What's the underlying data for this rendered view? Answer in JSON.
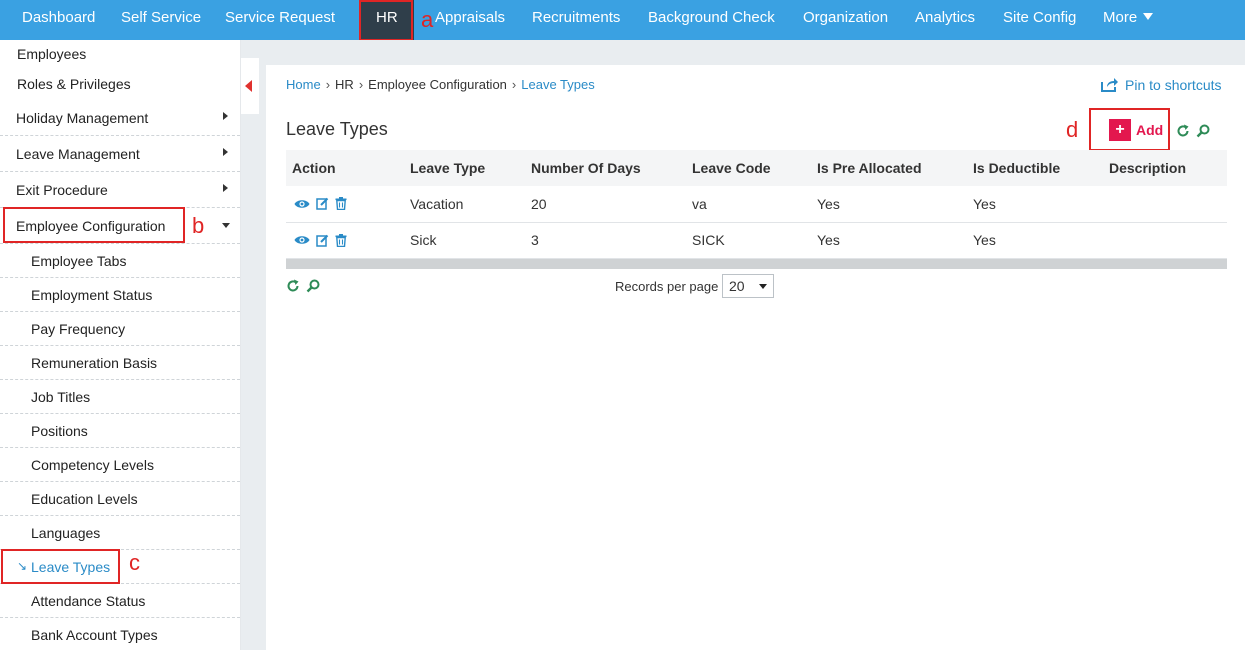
{
  "topnav": {
    "items": [
      "Dashboard",
      "Self Service",
      "Service Request",
      "HR",
      "Appraisals",
      "Recruitments",
      "Background Check",
      "Organization",
      "Analytics",
      "Site Config",
      "More"
    ],
    "active": "HR"
  },
  "annotations": {
    "a": "a",
    "b": "b",
    "c": "c",
    "d": "d"
  },
  "sidebar": {
    "top_items": [
      "Employees",
      "Roles & Privileges"
    ],
    "sections": [
      "Holiday Management",
      "Leave Management",
      "Exit Procedure",
      "Employee Configuration"
    ],
    "sub_items": [
      "Employee Tabs",
      "Employment Status",
      "Pay Frequency",
      "Remuneration Basis",
      "Job Titles",
      "Positions",
      "Competency Levels",
      "Education Levels",
      "Languages",
      "Leave Types",
      "Attendance Status",
      "Bank Account Types"
    ],
    "selected": "Leave Types"
  },
  "breadcrumb": [
    "Home",
    "HR",
    "Employee Configuration",
    "Leave Types"
  ],
  "pin_label": "Pin to shortcuts",
  "page_title": "Leave Types",
  "add_label": "Add",
  "table": {
    "headers": [
      "Action",
      "Leave Type",
      "Number Of Days",
      "Leave Code",
      "Is Pre Allocated",
      "Is Deductible",
      "Description"
    ],
    "rows": [
      [
        "Vacation",
        "20",
        "va",
        "Yes",
        "Yes",
        ""
      ],
      [
        "Sick",
        "3",
        "SICK",
        "Yes",
        "Yes",
        ""
      ]
    ]
  },
  "pager": {
    "records_label": "Records per page",
    "records_value": "20"
  },
  "colors": {
    "nav_bg": "#3aa1e2",
    "nav_active": "#2f3e4a",
    "accent": "#e3174e",
    "link": "#2a8bc7",
    "annotation": "#e02525"
  }
}
